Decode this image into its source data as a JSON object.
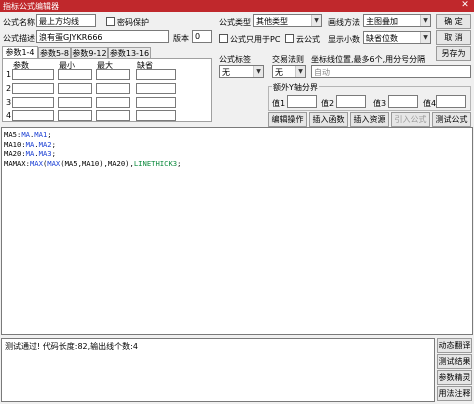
{
  "window": {
    "title": "指标公式编辑器",
    "close_glyph": "✕"
  },
  "form": {
    "name_label": "公式名称",
    "name_value": "最上方均线",
    "password_label": "密码保护",
    "desc_label": "公式描述",
    "desc_value": "浪有蛋GJYKR666",
    "version_label": "版本",
    "version_value": "0",
    "type_label": "公式类型",
    "type_value": "其他类型",
    "draw_label": "画线方法",
    "draw_value": "主图叠加",
    "pc_only_label": "公式只用于PC",
    "cloud_label": "云公式",
    "decimals_label": "显示小数",
    "decimals_value": "缺省位数",
    "tag_label": "公式标签",
    "tag_value": "无",
    "trade_label": "交易法则",
    "trade_value": "无",
    "coord_label": "坐标线位置,最多6个,用分号分隔",
    "coord_value": "自动",
    "extra_axis_label": "额外Y轴分界",
    "value_labels": [
      "值1",
      "值2",
      "值3",
      "值4"
    ]
  },
  "buttons": {
    "ok": "确 定",
    "cancel": "取 消",
    "save_as": "另存为",
    "edit_op": "编辑操作",
    "insert_func": "插入函数",
    "insert_res": "插入资源",
    "import_formula": "引入公式",
    "test_formula": "测试公式",
    "dynamic_translate": "动态翻译",
    "test_result": "测试结果",
    "param_wizard": "参数精灵",
    "usage_note": "用法注释"
  },
  "tabs": [
    {
      "label": "参数1-4",
      "active": true
    },
    {
      "label": "参数5-8",
      "active": false
    },
    {
      "label": "参数9-12",
      "active": false
    },
    {
      "label": "参数13-16",
      "active": false
    }
  ],
  "param_table": {
    "headers": [
      "参数",
      "最小",
      "最大",
      "缺省"
    ],
    "rows": [
      "1",
      "2",
      "3",
      "4"
    ]
  },
  "code_lines": [
    [
      {
        "t": "MA5:",
        "c": "black"
      },
      {
        "t": "MA",
        "c": "blue"
      },
      {
        "t": ".",
        "c": "black"
      },
      {
        "t": "MA1",
        "c": "blue"
      },
      {
        "t": ";",
        "c": "black"
      }
    ],
    [
      {
        "t": "MA10:",
        "c": "black"
      },
      {
        "t": "MA",
        "c": "blue"
      },
      {
        "t": ".",
        "c": "black"
      },
      {
        "t": "MA2",
        "c": "blue"
      },
      {
        "t": ";",
        "c": "black"
      }
    ],
    [
      {
        "t": "MA20:",
        "c": "black"
      },
      {
        "t": "MA",
        "c": "blue"
      },
      {
        "t": ".",
        "c": "black"
      },
      {
        "t": "MA3",
        "c": "blue"
      },
      {
        "t": ";",
        "c": "black"
      }
    ],
    [
      {
        "t": "MAMAX:",
        "c": "black"
      },
      {
        "t": "MAX",
        "c": "blue"
      },
      {
        "t": "(",
        "c": "black"
      },
      {
        "t": "MAX",
        "c": "blue"
      },
      {
        "t": "(MA5,MA10),MA20),",
        "c": "black"
      },
      {
        "t": "LINETHICK3",
        "c": "green"
      },
      {
        "t": ";",
        "c": "black"
      }
    ]
  ],
  "colors": {
    "titlebar": "#c0282c",
    "keyword": "#1a3fd4",
    "linestyle": "#0b8a3c"
  },
  "output": {
    "text": "测试通过! 代码长度:82,输出线个数:4"
  }
}
